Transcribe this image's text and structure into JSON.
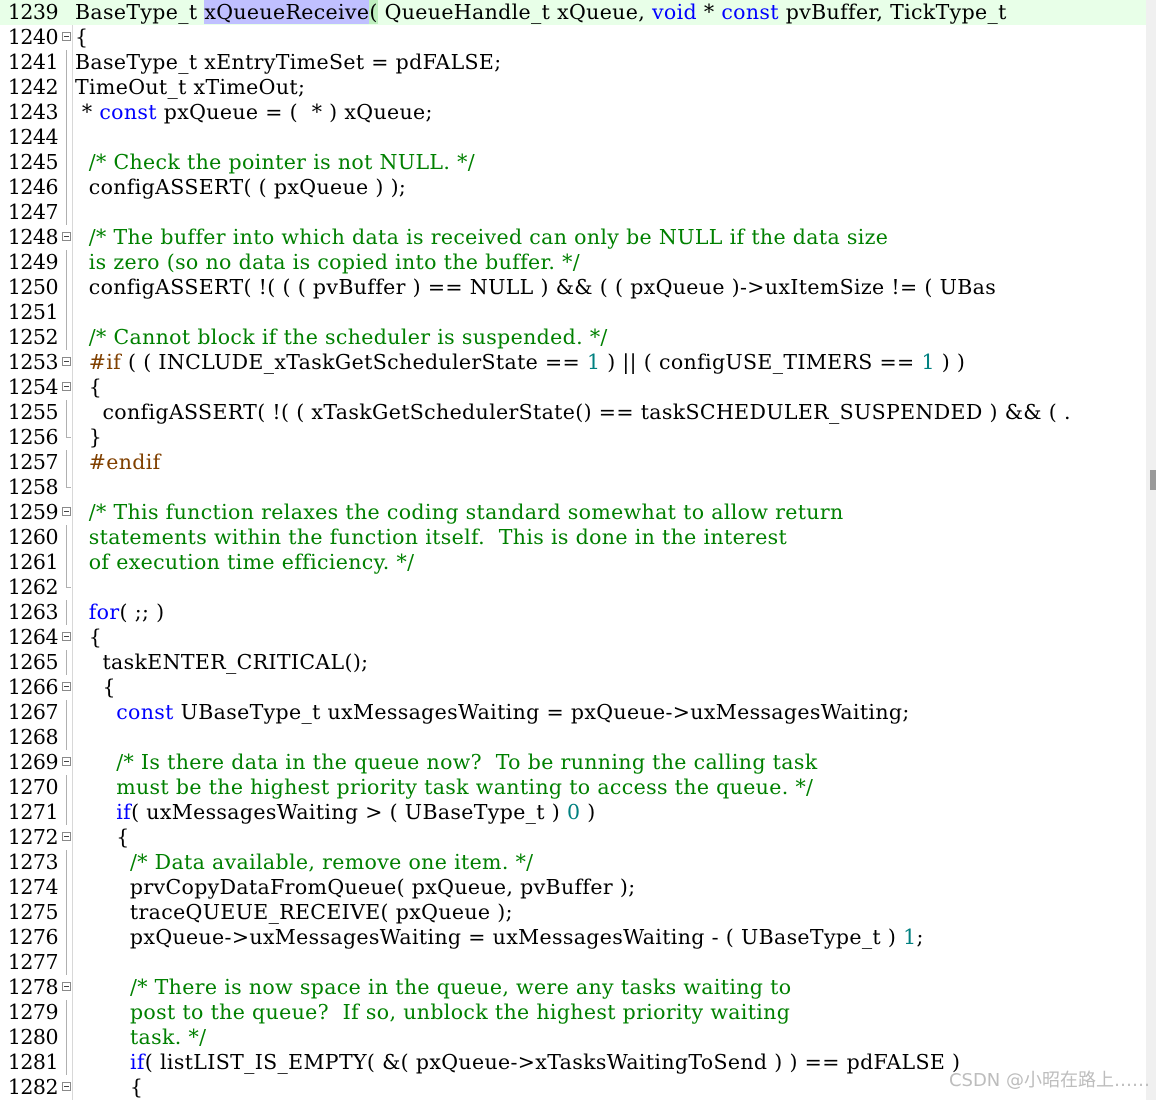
{
  "editor": {
    "lines": [
      {
        "n": "1239",
        "fold": "none",
        "segs": [
          [
            "",
            "BaseType_t "
          ],
          [
            "sel",
            "xQueueReceive"
          ],
          [
            "brace",
            "("
          ],
          [
            "",
            " QueueHandle_t xQueue, "
          ],
          [
            "kw",
            "void"
          ],
          [
            "",
            " * "
          ],
          [
            "kw",
            "const"
          ],
          [
            "",
            " pvBuffer, TickType_t "
          ]
        ]
      },
      {
        "n": "1240",
        "fold": "box",
        "segs": [
          [
            "",
            "{"
          ]
        ]
      },
      {
        "n": "1241",
        "fold": "line",
        "segs": [
          [
            "",
            "BaseType_t xEntryTimeSet = pdFALSE;"
          ]
        ]
      },
      {
        "n": "1242",
        "fold": "line",
        "segs": [
          [
            "",
            "TimeOut_t xTimeOut;"
          ]
        ]
      },
      {
        "n": "1243",
        "fold": "line",
        "segs": [
          [
            "",
            " * "
          ],
          [
            "kw",
            "const"
          ],
          [
            "",
            " pxQueue = (  * ) xQueue;"
          ]
        ]
      },
      {
        "n": "1244",
        "fold": "line",
        "segs": [
          [
            "",
            ""
          ]
        ]
      },
      {
        "n": "1245",
        "fold": "line",
        "segs": [
          [
            "",
            "  "
          ],
          [
            "cm",
            "/* Check the pointer is not NULL. */"
          ]
        ]
      },
      {
        "n": "1246",
        "fold": "line",
        "segs": [
          [
            "",
            "  configASSERT( ( pxQueue ) );"
          ]
        ]
      },
      {
        "n": "1247",
        "fold": "line",
        "segs": [
          [
            "",
            ""
          ]
        ]
      },
      {
        "n": "1248",
        "fold": "box",
        "segs": [
          [
            "",
            "  "
          ],
          [
            "cm",
            "/* The buffer into which data is received can only be NULL if the data size"
          ]
        ]
      },
      {
        "n": "1249",
        "fold": "line",
        "segs": [
          [
            "",
            "  "
          ],
          [
            "cm",
            "is zero (so no data is copied into the buffer. */"
          ]
        ]
      },
      {
        "n": "1250",
        "fold": "line",
        "segs": [
          [
            "",
            "  configASSERT( !( ( ( pvBuffer ) == NULL ) && ( ( pxQueue )->uxItemSize != ( UBas"
          ]
        ]
      },
      {
        "n": "1251",
        "fold": "line",
        "segs": [
          [
            "",
            ""
          ]
        ]
      },
      {
        "n": "1252",
        "fold": "line",
        "segs": [
          [
            "",
            "  "
          ],
          [
            "cm",
            "/* Cannot block if the scheduler is suspended. */"
          ]
        ]
      },
      {
        "n": "1253",
        "fold": "box",
        "segs": [
          [
            "",
            "  "
          ],
          [
            "pp",
            "#if"
          ],
          [
            "",
            " ( ( INCLUDE_xTaskGetSchedulerState == "
          ],
          [
            "num",
            "1"
          ],
          [
            "",
            " ) || ( configUSE_TIMERS == "
          ],
          [
            "num",
            "1"
          ],
          [
            "",
            " ) )"
          ]
        ]
      },
      {
        "n": "1254",
        "fold": "box",
        "segs": [
          [
            "",
            "  {"
          ]
        ]
      },
      {
        "n": "1255",
        "fold": "line",
        "segs": [
          [
            "",
            "    configASSERT( !( ( xTaskGetSchedulerState() == taskSCHEDULER_SUSPENDED ) && ( ."
          ]
        ]
      },
      {
        "n": "1256",
        "fold": "end",
        "segs": [
          [
            "",
            "  }"
          ]
        ]
      },
      {
        "n": "1257",
        "fold": "line",
        "segs": [
          [
            "",
            "  "
          ],
          [
            "pp",
            "#endif"
          ]
        ]
      },
      {
        "n": "1258",
        "fold": "end",
        "segs": [
          [
            "",
            ""
          ]
        ]
      },
      {
        "n": "1259",
        "fold": "box",
        "segs": [
          [
            "",
            "  "
          ],
          [
            "cm",
            "/* This function relaxes the coding standard somewhat to allow return"
          ]
        ]
      },
      {
        "n": "1260",
        "fold": "line",
        "segs": [
          [
            "",
            "  "
          ],
          [
            "cm",
            "statements within the function itself.  This is done in the interest"
          ]
        ]
      },
      {
        "n": "1261",
        "fold": "line",
        "segs": [
          [
            "",
            "  "
          ],
          [
            "cm",
            "of execution time efficiency. */"
          ]
        ]
      },
      {
        "n": "1262",
        "fold": "end",
        "segs": [
          [
            "",
            ""
          ]
        ]
      },
      {
        "n": "1263",
        "fold": "line",
        "segs": [
          [
            "",
            "  "
          ],
          [
            "kw",
            "for"
          ],
          [
            "",
            "( ;; )"
          ]
        ]
      },
      {
        "n": "1264",
        "fold": "box",
        "segs": [
          [
            "",
            "  {"
          ]
        ]
      },
      {
        "n": "1265",
        "fold": "line",
        "segs": [
          [
            "",
            "    taskENTER_CRITICAL();"
          ]
        ]
      },
      {
        "n": "1266",
        "fold": "box",
        "segs": [
          [
            "",
            "    {"
          ]
        ]
      },
      {
        "n": "1267",
        "fold": "line",
        "segs": [
          [
            "",
            "      "
          ],
          [
            "kw",
            "const"
          ],
          [
            "",
            " UBaseType_t uxMessagesWaiting = pxQueue->uxMessagesWaiting;"
          ]
        ]
      },
      {
        "n": "1268",
        "fold": "line",
        "segs": [
          [
            "",
            ""
          ]
        ]
      },
      {
        "n": "1269",
        "fold": "box",
        "segs": [
          [
            "",
            "      "
          ],
          [
            "cm",
            "/* Is there data in the queue now?  To be running the calling task"
          ]
        ]
      },
      {
        "n": "1270",
        "fold": "line",
        "segs": [
          [
            "",
            "      "
          ],
          [
            "cm",
            "must be the highest priority task wanting to access the queue. */"
          ]
        ]
      },
      {
        "n": "1271",
        "fold": "line",
        "segs": [
          [
            "",
            "      "
          ],
          [
            "kw",
            "if"
          ],
          [
            "",
            "( uxMessagesWaiting > ( UBaseType_t ) "
          ],
          [
            "num",
            "0"
          ],
          [
            "",
            " )"
          ]
        ]
      },
      {
        "n": "1272",
        "fold": "box",
        "segs": [
          [
            "",
            "      {"
          ]
        ]
      },
      {
        "n": "1273",
        "fold": "line",
        "segs": [
          [
            "",
            "        "
          ],
          [
            "cm",
            "/* Data available, remove one item. */"
          ]
        ]
      },
      {
        "n": "1274",
        "fold": "line",
        "segs": [
          [
            "",
            "        prvCopyDataFromQueue( pxQueue, pvBuffer );"
          ]
        ]
      },
      {
        "n": "1275",
        "fold": "line",
        "segs": [
          [
            "",
            "        traceQUEUE_RECEIVE( pxQueue );"
          ]
        ]
      },
      {
        "n": "1276",
        "fold": "line",
        "segs": [
          [
            "",
            "        pxQueue->uxMessagesWaiting = uxMessagesWaiting - ( UBaseType_t ) "
          ],
          [
            "num",
            "1"
          ],
          [
            "",
            ";"
          ]
        ]
      },
      {
        "n": "1277",
        "fold": "line",
        "segs": [
          [
            "",
            ""
          ]
        ]
      },
      {
        "n": "1278",
        "fold": "box",
        "segs": [
          [
            "",
            "        "
          ],
          [
            "cm",
            "/* There is now space in the queue, were any tasks waiting to"
          ]
        ]
      },
      {
        "n": "1279",
        "fold": "line",
        "segs": [
          [
            "",
            "        "
          ],
          [
            "cm",
            "post to the queue?  If so, unblock the highest priority waiting"
          ]
        ]
      },
      {
        "n": "1280",
        "fold": "line",
        "segs": [
          [
            "",
            "        "
          ],
          [
            "cm",
            "task. */"
          ]
        ]
      },
      {
        "n": "1281",
        "fold": "line",
        "segs": [
          [
            "",
            "        "
          ],
          [
            "kw",
            "if"
          ],
          [
            "",
            "( listLIST_IS_EMPTY( &( pxQueue->xTasksWaitingToSend ) ) == pdFALSE )"
          ]
        ]
      },
      {
        "n": "1282",
        "fold": "box",
        "segs": [
          [
            "",
            "        {"
          ]
        ]
      }
    ]
  },
  "watermark": "CSDN @小昭在路上……"
}
